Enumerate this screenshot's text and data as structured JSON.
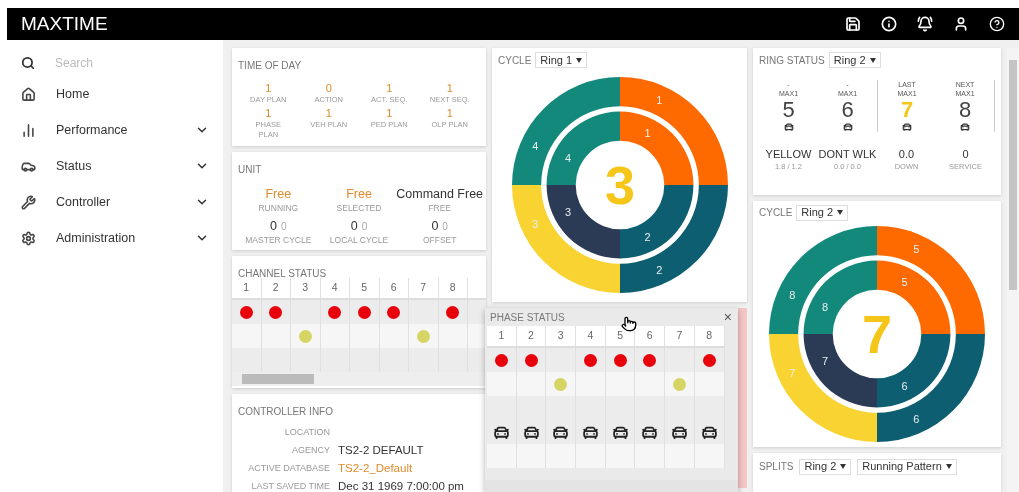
{
  "header": {
    "title": "MAXTIME"
  },
  "sidebar": {
    "search_placeholder": "Search",
    "items": [
      {
        "label": "Home",
        "expandable": false
      },
      {
        "label": "Performance",
        "expandable": true
      },
      {
        "label": "Status",
        "expandable": true
      },
      {
        "label": "Controller",
        "expandable": true
      },
      {
        "label": "Administration",
        "expandable": true
      }
    ]
  },
  "time_of_day": {
    "title": "TIME OF DAY",
    "fields": [
      {
        "value": "1",
        "label": "DAY PLAN"
      },
      {
        "value": "0",
        "label": "ACTION"
      },
      {
        "value": "1",
        "label": "ACT. SEQ."
      },
      {
        "value": "1",
        "label": "NEXT SEQ."
      },
      {
        "value": "1",
        "label": "PHASE PLAN"
      },
      {
        "value": "1",
        "label": "VEH PLAN"
      },
      {
        "value": "1",
        "label": "PED PLAN"
      },
      {
        "value": "1",
        "label": "OLP PLAN"
      }
    ]
  },
  "unit": {
    "title": "UNIT",
    "modes": [
      {
        "value": "Free",
        "label": "RUNNING",
        "highlighted": true
      },
      {
        "value": "Free",
        "label": "SELECTED",
        "highlighted": true
      },
      {
        "value": "Command Free",
        "label": "FREE",
        "highlighted": false
      }
    ],
    "cycles": [
      {
        "value": "0",
        "sub": "0",
        "label": "MASTER CYCLE"
      },
      {
        "value": "0",
        "sub": "0",
        "label": "LOCAL CYCLE"
      },
      {
        "value": "0",
        "sub": "0",
        "label": "OFFSET"
      }
    ]
  },
  "channel_status": {
    "title": "CHANNEL STATUS",
    "columns": [
      "1",
      "2",
      "3",
      "4",
      "5",
      "6",
      "7",
      "8"
    ],
    "rows": [
      {
        "kind": "red",
        "on": [
          true,
          true,
          false,
          true,
          true,
          true,
          false,
          true
        ]
      },
      {
        "kind": "yellow",
        "on": [
          false,
          false,
          true,
          false,
          false,
          false,
          true,
          false
        ]
      },
      {
        "kind": "green",
        "on": [
          false,
          false,
          false,
          false,
          false,
          false,
          false,
          false
        ]
      }
    ]
  },
  "controller_info": {
    "title": "CONTROLLER INFO",
    "fields": [
      {
        "label": "LOCATION"
      },
      {
        "label": "AGENCY",
        "value": "TS2-2 DEFAULT",
        "highlighted": false
      },
      {
        "label": "ACTIVE DATABASE",
        "value": "TS2-2_Default",
        "highlighted": true
      },
      {
        "label": "LAST SAVED TIME",
        "value": "Dec 31 1969 7:00:00 pm",
        "highlighted": false
      }
    ]
  },
  "cycle_charts": [
    {
      "title": "CYCLE",
      "ring": "Ring 1",
      "current": "3",
      "outer": [
        {
          "label": "1",
          "color": "#fe6a00"
        },
        {
          "label": "2",
          "color": "#0d5e70"
        },
        {
          "label": "3",
          "color": "#f8d331"
        },
        {
          "label": "4",
          "color": "#12897a"
        }
      ],
      "inner": [
        {
          "label": "1",
          "color": "#fe6a00"
        },
        {
          "label": "2",
          "color": "#0d5e70"
        },
        {
          "label": "3",
          "color": "#2b3a55"
        },
        {
          "label": "4",
          "color": "#12897a"
        }
      ]
    },
    {
      "title": "CYCLE",
      "ring": "Ring 2",
      "current": "7",
      "outer": [
        {
          "label": "5",
          "color": "#fe6a00"
        },
        {
          "label": "6",
          "color": "#0d5e70"
        },
        {
          "label": "7",
          "color": "#f8d331"
        },
        {
          "label": "8",
          "color": "#12897a"
        }
      ],
      "inner": [
        {
          "label": "5",
          "color": "#fe6a00"
        },
        {
          "label": "6",
          "color": "#0d5e70"
        },
        {
          "label": "7",
          "color": "#2b3a55"
        },
        {
          "label": "8",
          "color": "#12897a"
        }
      ]
    }
  ],
  "phase_status": {
    "title": "PHASE STATUS",
    "close": "×",
    "columns": [
      "1",
      "2",
      "3",
      "4",
      "5",
      "6",
      "7",
      "8"
    ],
    "rows": [
      {
        "kind": "red",
        "on": [
          true,
          true,
          false,
          true,
          true,
          true,
          false,
          true
        ]
      },
      {
        "kind": "yellow",
        "on": [
          false,
          false,
          true,
          false,
          false,
          false,
          true,
          false
        ]
      },
      {
        "kind": "green",
        "on": [
          false,
          false,
          false,
          false,
          false,
          false,
          false,
          false
        ]
      },
      {
        "kind": "vehicle",
        "on": [
          true,
          true,
          true,
          true,
          true,
          true,
          true,
          true
        ]
      },
      {
        "kind": "ped",
        "on": [
          false,
          false,
          false,
          false,
          false,
          false,
          false,
          false
        ]
      }
    ]
  },
  "ring_status": {
    "title": "RING STATUS",
    "ring": "Ring 2",
    "phases": [
      {
        "top": "-",
        "interval": "MAX1",
        "number": "5",
        "selected": false
      },
      {
        "top": "-",
        "interval": "MAX1",
        "number": "6",
        "selected": false
      },
      {
        "top": "LAST",
        "interval": "MAX1",
        "number": "7",
        "selected": true
      },
      {
        "top": "NEXT",
        "interval": "MAX1",
        "number": "8",
        "selected": false
      }
    ],
    "stats": [
      {
        "value": "YELLOW",
        "label": "1.8 / 1.2"
      },
      {
        "value": "DONT WLK",
        "label": "0.0 / 0.0"
      },
      {
        "value": "0.0",
        "label": "DOWN"
      },
      {
        "value": "0",
        "label": "SERVICE"
      }
    ]
  },
  "splits": {
    "title": "SPLITS",
    "ring": "Ring 2",
    "pattern": "Running Pattern"
  }
}
